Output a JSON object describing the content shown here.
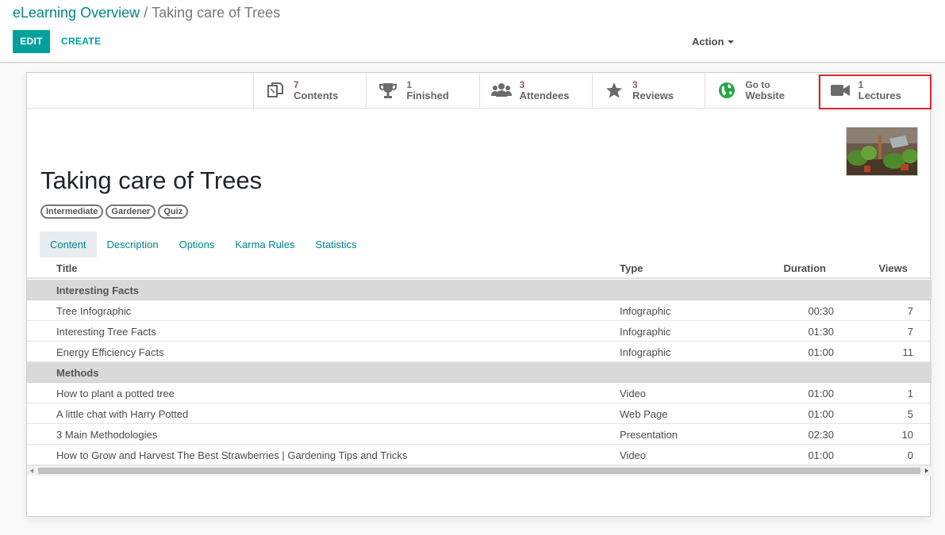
{
  "breadcrumb": {
    "parent": "eLearning Overview",
    "separator": "/",
    "current": "Taking care of Trees"
  },
  "toolbar": {
    "edit_label": "EDIT",
    "create_label": "CREATE",
    "action_label": "Action"
  },
  "stat_buttons": [
    {
      "count": "7",
      "label": "Contents",
      "icon": "copy-icon"
    },
    {
      "count": "1",
      "label": "Finished",
      "icon": "trophy-icon"
    },
    {
      "count": "3",
      "label": "Attendees",
      "icon": "users-icon"
    },
    {
      "count": "3",
      "label": "Reviews",
      "icon": "star-icon"
    },
    {
      "count": "Go to",
      "label": "Website",
      "icon": "globe-icon"
    },
    {
      "count": "1",
      "label": "Lectures",
      "icon": "video-camera-icon"
    }
  ],
  "course": {
    "title": "Taking care of Trees",
    "tags": [
      "Intermediate",
      "Gardener",
      "Quiz"
    ]
  },
  "tabs": [
    "Content",
    "Description",
    "Options",
    "Karma Rules",
    "Statistics"
  ],
  "table": {
    "headers": {
      "title": "Title",
      "type": "Type",
      "duration": "Duration",
      "views": "Views"
    },
    "rows": [
      {
        "section": "Interesting Facts"
      },
      {
        "title": "Tree Infographic",
        "type": "Infographic",
        "duration": "00:30",
        "views": "7"
      },
      {
        "title": "Interesting Tree Facts",
        "type": "Infographic",
        "duration": "01:30",
        "views": "7"
      },
      {
        "title": "Energy Efficiency Facts",
        "type": "Infographic",
        "duration": "01:00",
        "views": "11"
      },
      {
        "section": "Methods"
      },
      {
        "title": "How to plant a potted tree",
        "type": "Video",
        "duration": "01:00",
        "views": "1"
      },
      {
        "title": "A little chat with Harry Potted",
        "type": "Web Page",
        "duration": "01:00",
        "views": "5"
      },
      {
        "title": "3 Main Methodologies",
        "type": "Presentation",
        "duration": "02:30",
        "views": "10"
      },
      {
        "title": "How to Grow and Harvest The Best Strawberries | Gardening Tips and Tricks",
        "type": "Video",
        "duration": "01:00",
        "views": "0"
      }
    ]
  },
  "colors": {
    "accent": "#00a09d",
    "link": "#01848a",
    "stat_number": "#875a7b",
    "highlight": "#e0252b"
  }
}
